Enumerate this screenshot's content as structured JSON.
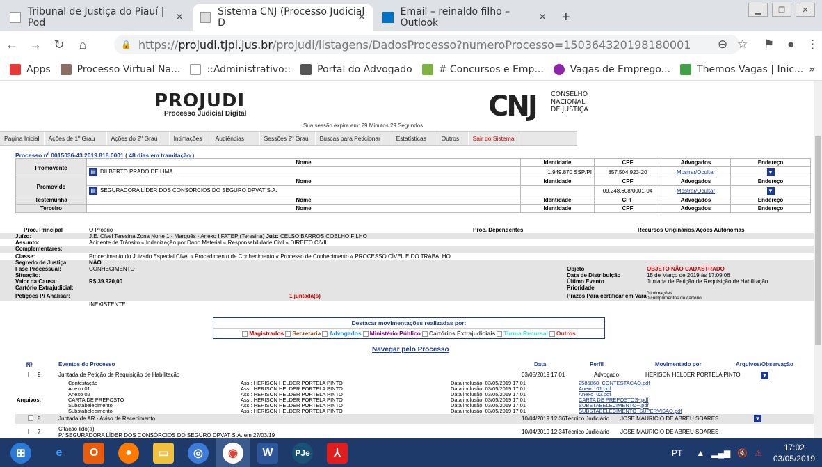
{
  "browser": {
    "tabs": [
      {
        "title": "Tribunal de Justiça do Piauí | Pod",
        "icon": "page-icon"
      },
      {
        "title": "Sistema CNJ (Processo Judicial D",
        "icon": "projudi-icon"
      },
      {
        "title": "Email – reinaldo filho – Outlook",
        "icon": "outlook-icon"
      }
    ],
    "url_scheme": "https://",
    "url_host": "projudi.tjpi.jus.br",
    "url_path": "/projudi/listagens/DadosProcesso?numeroProcesso=150364320198180001",
    "bookmarks": [
      {
        "label": "Apps",
        "color": "#e53935"
      },
      {
        "label": "Processo Virtual Na...",
        "color": "#8d6e63"
      },
      {
        "label": "::Administrativo::",
        "color": "#9e9e9e"
      },
      {
        "label": "Portal do Advogado",
        "color": "#555555"
      },
      {
        "label": "# Concursos e Emp...",
        "color": "#7cb342"
      },
      {
        "label": "Vagas de Emprego...",
        "color": "#8e24aa"
      },
      {
        "label": "Themos Vagas | Inic...",
        "color": "#43a047"
      }
    ],
    "more": "»"
  },
  "header": {
    "logo": "PROJUDI",
    "subtitle": "Processo Judicial Digital",
    "cnj": "CNJ",
    "cnj_l1": "CONSELHO",
    "cnj_l2": "NACIONAL",
    "cnj_l3": "DE JUSTIÇA",
    "session": "Sua sessão expira em: 29 Minutos 29 Segundos"
  },
  "menu": [
    "Pagina Inicial",
    "Ações de 1º Grau",
    "Ações do 2º Grau",
    "Intimações",
    "Audiências",
    "Sessões 2º Grau",
    "Buscas para Peticionar",
    "Estatísticas",
    "Outros",
    "Sair do Sistema"
  ],
  "process": {
    "title": "Processo nº 0015036-43.2019.818.0001 ( 48 dias em tramitação )",
    "h_nome": "Nome",
    "h_ident": "Identidade",
    "h_cpf": "CPF",
    "h_adv": "Advogados",
    "h_end": "Endereço",
    "promovente_label": "Promovente",
    "promovente_nome": "DILBERTO PRADO DE LIMA",
    "promovente_ident": "1.949.870 SSP/PI",
    "promovente_cpf": "857.504.923-20",
    "mostrar": "Mostrar/Ocultar",
    "promovido_label": "Promovido",
    "promovido_nome": "SEGURADORA LÍDER DOS CONSÓRCIOS DO SEGURO DPVAT S.A.",
    "promovido_ident": "",
    "promovido_cpf": "09.248.608/0001-04",
    "testemunha_label": "Testemunha",
    "terceiro_label": "Terceiro",
    "proc_principal_label": "Proc. Principal",
    "proc_principal": "O Próprio",
    "proc_dependentes": "Proc. Dependentes",
    "recursos": "Recursos Originários/Ações Autônomas",
    "juizo_k": "Juízo:",
    "juizo_v": "J.E. Cível Teresina Zona Norte 1 - Marquês - Anexo I FATEPI(Teresina)",
    "juiz_k": "Juiz:",
    "juiz_v": "CELSO BARROS COELHO FILHO",
    "assunto_k": "Assunto:",
    "assunto_v": "Acidente de Trânsito « Indenização por Dano Material « Responsabilidade Civil « DIREITO CIVIL",
    "complementares_k": "Complementares:",
    "classe_k": "Classe:",
    "classe_v": "Procedimento do Juizado Especial Cível « Procedimento de Conhecimento « Processo de Conhecimento « PROCESSO CÍVEL E DO TRABALHO",
    "segredo_k": "Segredo de Justiça",
    "segredo_v": "NÃO",
    "fase_k": "Fase Processual:",
    "fase_v": "CONHECIMENTO",
    "situacao_k": "Situação:",
    "valor_k": "Valor da Causa:",
    "valor_v": "R$ 39.920,00",
    "cartorio_k": "Cartório Extrajudicial:",
    "peticoes_k": "Petições P/ Analisar:",
    "peticoes_v": "1 juntada(s)",
    "inexistente": "INEXISTENTE",
    "objeto_k": "Objeto",
    "objeto_v": "OBJETO NÃO CADASTRADO",
    "distrib_k": "Data de Distribuição",
    "distrib_v": "15 de Março de 2019 às 17:09:06",
    "ultimo_k": "Último Evento",
    "ultimo_v": "Juntada de Petição de Requisição de Habilitação",
    "prioridade_k": "Prioridade",
    "prazos_k": "Prazos Para certificar em Vara",
    "prazos_v1": "0 intimações",
    "prazos_v2": "0 cumprimentos do cartório"
  },
  "destaque": {
    "title": "Destacar movimentações realizadas por:",
    "options": [
      {
        "label": "Magistrados",
        "color": "#c00000"
      },
      {
        "label": "Secretaria",
        "color": "#8b4513"
      },
      {
        "label": "Advogados",
        "color": "#1e90ff"
      },
      {
        "label": "Ministério Público",
        "color": "#8b008b"
      },
      {
        "label": "Cartórios Extrajudiciais",
        "color": "#444444"
      },
      {
        "label": "Turma Recursal",
        "color": "#40e0d0"
      },
      {
        "label": "Outros",
        "color": "#cc3333"
      }
    ]
  },
  "nav_processo": "Navegar pelo Processo",
  "events_header": {
    "n": "Nº",
    "eventos": "Eventos do Processo",
    "data": "Data",
    "perfil": "Perfil",
    "movimentado": "Movimentado por",
    "arquivos": "Arquivos/Observação"
  },
  "events": [
    {
      "n": "9",
      "title": "Juntada de Petição de Requisição de Habilitação",
      "date": "03/05/2019 17:01",
      "perfil": "Advogado",
      "by": "HERISON HELDER PORTELA PINTO"
    },
    {
      "n": "8",
      "title": "Juntada de AR - Aviso de Recebimento",
      "date": "10/04/2019 12:36",
      "perfil": "Técnico Judiciário",
      "by": "JOSE MAURICIO DE ABREU SOARES"
    },
    {
      "n": "7",
      "title": "Citação lido(a)",
      "title2": "P/ SEGURADORA LÍDER DOS CONSÓRCIOS DO SEGURO DPVAT S.A. em 27/03/19",
      "date": "10/04/2019 12:34",
      "perfil": "Técnico Judiciário",
      "by": "JOSE MAURICIO DE ABREU SOARES"
    }
  ],
  "arquivos_label": "Arquivos:",
  "files": [
    {
      "name": "Contestação",
      "ass": "Ass.: HERISON HELDER PORTELA PINTO",
      "incl": "Data inclusão: 03/05/2019 17:01",
      "file": "2585868_CONTESTACAO.pdf"
    },
    {
      "name": "Anexo 01",
      "ass": "Ass.: HERISON HELDER PORTELA PINTO",
      "incl": "Data inclusão: 03/05/2019 17:01",
      "file": "Anexo_01.pdf"
    },
    {
      "name": "Anexo 02",
      "ass": "Ass.: HERISON HELDER PORTELA PINTO",
      "incl": "Data inclusão: 03/05/2019 17:01",
      "file": "Anexo_02.pdf"
    },
    {
      "name": "CARTA DE PREPOSTO",
      "ass": "Ass.: HERISON HELDER PORTELA PINTO",
      "incl": "Data inclusão: 03/05/2019 17:01",
      "file": "CARTA DE PREPOSTOS-.pdf"
    },
    {
      "name": "Substabelecimento",
      "ass": "Ass.: HERISON HELDER PORTELA PINTO",
      "incl": "Data inclusão: 03/05/2019 17:01",
      "file": "SUBSTABELECIMENTO--.pdf"
    },
    {
      "name": "Substabelecimento",
      "ass": "Ass.: HERISON HELDER PORTELA PINTO",
      "incl": "Data inclusão: 03/05/2019 17:01",
      "file": "SUBSTABELECIMENTO_SUPERVISAO.pdf"
    }
  ],
  "taskbar": {
    "lang": "PT",
    "time": "17:02",
    "date": "03/05/2019"
  }
}
